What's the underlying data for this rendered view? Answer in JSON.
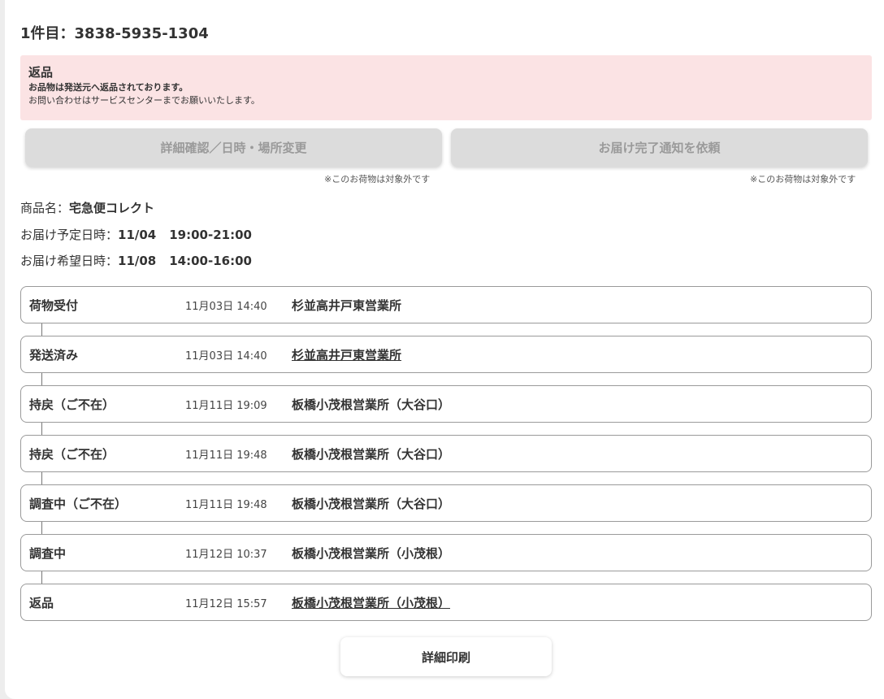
{
  "header": {
    "title": "1件目：3838-5935-1304"
  },
  "notice": {
    "heading": "返品",
    "line1": "お品物は発送元へ返品されております。",
    "line2": "お問い合わせはサービスセンターまでお願いいたします。"
  },
  "actions": {
    "detail_change_label": "詳細確認／日時・場所変更",
    "detail_change_note": "※このお荷物は対象外です",
    "delivery_notice_label": "お届け完了通知を依頼",
    "delivery_notice_note": "※このお荷物は対象外です"
  },
  "info": {
    "product_label": "商品名：",
    "product_value": "宅急便コレクト",
    "scheduled_label": "お届け予定日時：",
    "scheduled_date": "11/04",
    "scheduled_time": "19:00-21:00",
    "desired_label": "お届け希望日時：",
    "desired_date": "11/08",
    "desired_time": "14:00-16:00"
  },
  "timeline": [
    {
      "status": "荷物受付",
      "datetime": "11月03日 14:40",
      "office": "杉並高井戸東営業所",
      "link": false
    },
    {
      "status": "発送済み",
      "datetime": "11月03日 14:40",
      "office": "杉並高井戸東営業所",
      "link": true
    },
    {
      "status": "持戻（ご不在）",
      "datetime": "11月11日 19:09",
      "office": "板橋小茂根営業所（大谷口）",
      "link": false
    },
    {
      "status": "持戻（ご不在）",
      "datetime": "11月11日 19:48",
      "office": "板橋小茂根営業所（大谷口）",
      "link": false
    },
    {
      "status": "調査中（ご不在）",
      "datetime": "11月11日 19:48",
      "office": "板橋小茂根営業所（大谷口）",
      "link": false
    },
    {
      "status": "調査中",
      "datetime": "11月12日 10:37",
      "office": "板橋小茂根営業所（小茂根）",
      "link": false
    },
    {
      "status": "返品",
      "datetime": "11月12日 15:57",
      "office": "板橋小茂根営業所（小茂根）",
      "link": true
    }
  ],
  "footer": {
    "print_label": "詳細印刷"
  },
  "colors": {
    "notice_bg": "#fbe3e4",
    "disabled_button": "#dcdcdc"
  }
}
